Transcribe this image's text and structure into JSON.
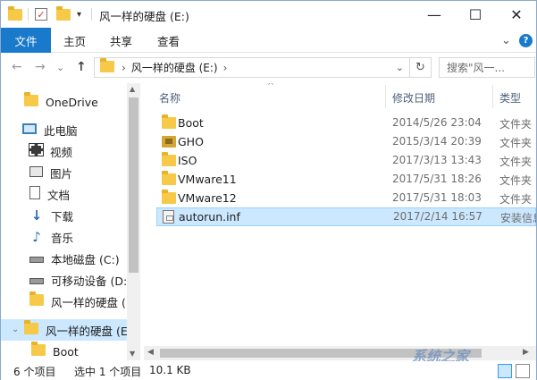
{
  "window": {
    "title": "风一样的硬盘 (E:)",
    "minimize_glyph": "—",
    "maximize_glyph": "☐",
    "close_glyph": "✕"
  },
  "ribbon": {
    "file_tab": "文件",
    "tabs": [
      "主页",
      "共享",
      "查看"
    ],
    "expand_glyph": "⌄",
    "help_glyph": "?"
  },
  "address": {
    "path": "风一样的硬盘 (E:)",
    "chevron": "›",
    "dropdown_glyph": "⌄",
    "refresh_glyph": "↻",
    "search_placeholder": "搜索\"风一..."
  },
  "nav_glyphs": {
    "back": "←",
    "forward": "→",
    "recent": "⌄",
    "up": "↑"
  },
  "sidebar": {
    "onedrive": "OneDrive",
    "thispc": "此电脑",
    "items": [
      "视频",
      "图片",
      "文档",
      "下载",
      "音乐",
      "本地磁盘 (C:)",
      "可移动设备 (D:)",
      "风一样的硬盘 (E"
    ],
    "selected": "风一样的硬盘 (E:)",
    "child": "Boot"
  },
  "columns": {
    "name": "名称",
    "date": "修改日期",
    "type": "类型",
    "sort_glyph": "^"
  },
  "files": [
    {
      "name": "Boot",
      "date": "2014/5/26 23:04",
      "type": "文件夹",
      "icon": "folder-icon"
    },
    {
      "name": "GHO",
      "date": "2015/3/14 20:39",
      "type": "文件夹",
      "icon": "gho-folder-icon"
    },
    {
      "name": "ISO",
      "date": "2017/3/13 13:43",
      "type": "文件夹",
      "icon": "folder-icon"
    },
    {
      "name": "VMware11",
      "date": "2017/5/31 18:26",
      "type": "文件夹",
      "icon": "folder-icon"
    },
    {
      "name": "VMware12",
      "date": "2017/5/31 18:03",
      "type": "文件夹",
      "icon": "folder-icon"
    },
    {
      "name": "autorun.inf",
      "date": "2017/2/14 16:57",
      "type": "安装信息",
      "icon": "setup-info-icon"
    }
  ],
  "status": {
    "count": "6 个项目",
    "selected": "选中 1 个项目",
    "size": "10.1 KB"
  },
  "watermark": "系统之家",
  "colors": {
    "accent": "#1979ca",
    "selection": "#cce8ff",
    "folder": "#f7c948"
  }
}
